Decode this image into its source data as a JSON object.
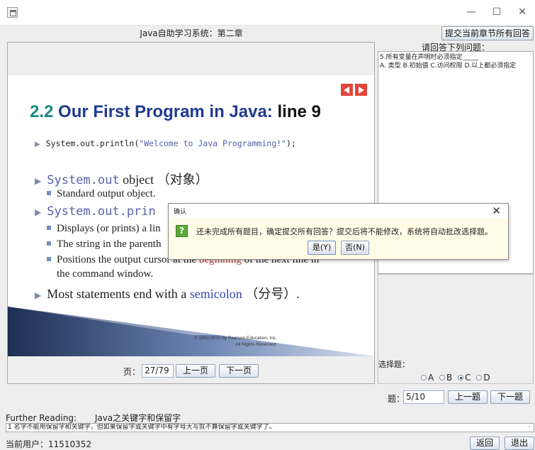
{
  "window": {
    "title": "",
    "controls": {
      "minimize": "—",
      "maximize": "☐",
      "close": "✕"
    }
  },
  "header": {
    "chapter_title": "Java自助学习系统：第二章",
    "submit_all_label": "提交当前章节所有回答"
  },
  "slide": {
    "title_part1": "2.2",
    "title_part2": "Our First Program in Java:",
    "title_part3": "line 9",
    "code_line_prefix": "System.out.println(",
    "code_line_string": "\"Welcome to Java Programming!\"",
    "code_line_suffix": ");",
    "b1_code": "System.out",
    "b1_text": " object （对象）",
    "b1_sub": "Standard output object.",
    "b2_code": "System.out.prin",
    "s2_1": "Displays (or prints) a lin",
    "s2_2": "The string in the parenth",
    "s2_3_pre": "Positions the output curs",
    "s2_3_hidden_mid": "or at the ",
    "s2_3_red": "beginning",
    "s2_3_post": " of the next line in",
    "s2_3_line2": "the command window.",
    "b3_text": "Most statements end with a ",
    "b3_blue": "semicolon",
    "b3_after": " （分号）.",
    "copyright_line1": "© 1992-2010 by Pearson Education, Inc.",
    "copyright_line2": "All Rights Reserved.",
    "prev_arrow": "◀",
    "next_arrow": "▶"
  },
  "pager": {
    "page_label": "页：",
    "page_value": "27/79",
    "prev_label": "上一页",
    "next_label": "下一页"
  },
  "qa": {
    "title": "请回答下列问题：",
    "question": "5.所有变量在声明时必须指定_____",
    "options_text": "A. 类型  B.初始值  C.访问权限  D.以上都必须指定",
    "choice_label": "选择题：",
    "choices": [
      "A",
      "B",
      "C",
      "D"
    ],
    "selected": "C",
    "question_label": "题：",
    "question_value": "5/10",
    "prev_label": "上一题",
    "next_label": "下一题"
  },
  "footer": {
    "further_label": "Further Reading:",
    "further_value": "Java之关键字和保留字",
    "tip_text": "1 名字不能用保留字和关键字，但如果保留字或关键字中有字母大写就不算保留字或关键字了。",
    "user_label": "当前用户：11510352",
    "back_label": "返回",
    "exit_label": "退出"
  },
  "dialog": {
    "title": "确认",
    "close": "✕",
    "icon": "?",
    "message": "还未完成所有题目，确定提交所有回答？提交后将不能修改，系统将自动批改选择题。",
    "yes_label": "是(Y)",
    "no_label": "否(N)"
  },
  "colors": {
    "slide_title_number": "#1a8a7e",
    "slide_title_main": "#1f3b8f",
    "accent_red": "#e2473a",
    "code_blue": "#5561a8",
    "dialog_bg": "#fffce8",
    "question_icon": "#5ea83a"
  }
}
